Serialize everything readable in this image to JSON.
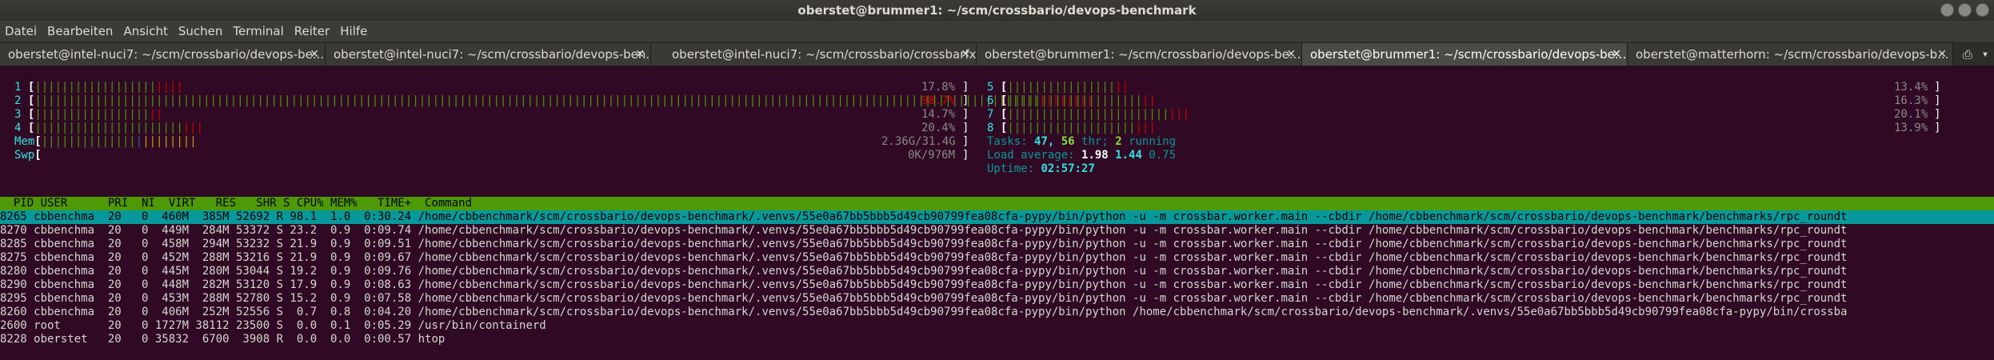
{
  "window": {
    "title": "oberstet@brummer1: ~/scm/crossbario/devops-benchmark"
  },
  "menu": [
    "Datei",
    "Bearbeiten",
    "Ansicht",
    "Suchen",
    "Terminal",
    "Reiter",
    "Hilfe"
  ],
  "tabs": [
    {
      "label": "oberstet@intel-nuci7: ~/scm/crossbario/devops-be...",
      "active": false
    },
    {
      "label": "oberstet@intel-nuci7: ~/scm/crossbario/devops-ben...",
      "active": false
    },
    {
      "label": "oberstet@intel-nuci7: ~/scm/crossbario/crossbarfx",
      "active": false
    },
    {
      "label": "oberstet@brummer1: ~/scm/crossbario/devops-be...",
      "active": false
    },
    {
      "label": "oberstet@brummer1: ~/scm/crossbario/devops-be...",
      "active": true
    },
    {
      "label": "oberstet@matterhorn: ~/scm/crossbario/devops-b...",
      "active": false
    }
  ],
  "meters": {
    "cpu_left": [
      {
        "n": "1",
        "pct": "17.8%"
      },
      {
        "n": "2",
        "pct": "98.7%"
      },
      {
        "n": "3",
        "pct": "14.7%"
      },
      {
        "n": "4",
        "pct": "20.4%"
      }
    ],
    "cpu_right": [
      {
        "n": "5",
        "pct": "13.4%"
      },
      {
        "n": "6",
        "pct": "16.3%"
      },
      {
        "n": "7",
        "pct": "20.1%"
      },
      {
        "n": "8",
        "pct": "13.9%"
      }
    ],
    "mem": {
      "label": "Mem",
      "value": "2.36G/31.4G"
    },
    "swp": {
      "label": "Swp",
      "value": "0K/976M"
    }
  },
  "summary": {
    "tasks_label": "Tasks:",
    "tasks": "47,",
    "thr": "56",
    "thr_label": "thr;",
    "running": "2",
    "running_label": "running",
    "load_label": "Load average:",
    "load1": "1.98",
    "load5": "1.44",
    "load15": "0.75",
    "uptime_label": "Uptime:",
    "uptime": "02:57:27"
  },
  "proc_header": "  PID USER      PRI  NI  VIRT   RES   SHR S CPU% MEM%   TIME+  Command",
  "processes": [
    "8265 cbbenchma  20   0  460M  385M 52692 R 98.1  1.0  0:30.24 /home/cbbenchmark/scm/crossbario/devops-benchmark/.venvs/55e0a67bb5bbb5d49cb90799fea08cfa-pypy/bin/python -u -m crossbar.worker.main --cbdir /home/cbbenchmark/scm/crossbario/devops-benchmark/benchmarks/rpc_roundt",
    "8270 cbbenchma  20   0  449M  284M 53372 S 23.2  0.9  0:09.74 /home/cbbenchmark/scm/crossbario/devops-benchmark/.venvs/55e0a67bb5bbb5d49cb90799fea08cfa-pypy/bin/python -u -m crossbar.worker.main --cbdir /home/cbbenchmark/scm/crossbario/devops-benchmark/benchmarks/rpc_roundt",
    "8285 cbbenchma  20   0  458M  294M 53232 S 21.9  0.9  0:09.51 /home/cbbenchmark/scm/crossbario/devops-benchmark/.venvs/55e0a67bb5bbb5d49cb90799fea08cfa-pypy/bin/python -u -m crossbar.worker.main --cbdir /home/cbbenchmark/scm/crossbario/devops-benchmark/benchmarks/rpc_roundt",
    "8275 cbbenchma  20   0  452M  288M 53216 S 21.9  0.9  0:09.67 /home/cbbenchmark/scm/crossbario/devops-benchmark/.venvs/55e0a67bb5bbb5d49cb90799fea08cfa-pypy/bin/python -u -m crossbar.worker.main --cbdir /home/cbbenchmark/scm/crossbario/devops-benchmark/benchmarks/rpc_roundt",
    "8280 cbbenchma  20   0  445M  280M 53044 S 19.2  0.9  0:09.76 /home/cbbenchmark/scm/crossbario/devops-benchmark/.venvs/55e0a67bb5bbb5d49cb90799fea08cfa-pypy/bin/python -u -m crossbar.worker.main --cbdir /home/cbbenchmark/scm/crossbario/devops-benchmark/benchmarks/rpc_roundt",
    "8290 cbbenchma  20   0  448M  282M 53120 S 17.9  0.9  0:08.63 /home/cbbenchmark/scm/crossbario/devops-benchmark/.venvs/55e0a67bb5bbb5d49cb90799fea08cfa-pypy/bin/python -u -m crossbar.worker.main --cbdir /home/cbbenchmark/scm/crossbario/devops-benchmark/benchmarks/rpc_roundt",
    "8295 cbbenchma  20   0  453M  288M 52780 S 15.2  0.9  0:07.58 /home/cbbenchmark/scm/crossbario/devops-benchmark/.venvs/55e0a67bb5bbb5d49cb90799fea08cfa-pypy/bin/python -u -m crossbar.worker.main --cbdir /home/cbbenchmark/scm/crossbario/devops-benchmark/benchmarks/rpc_roundt",
    "8260 cbbenchma  20   0  406M  252M 52556 S  0.7  0.8  0:04.20 /home/cbbenchmark/scm/crossbario/devops-benchmark/.venvs/55e0a67bb5bbb5d49cb90799fea08cfa-pypy/bin/python /home/cbbenchmark/scm/crossbario/devops-benchmark/.venvs/55e0a67bb5bbb5d49cb90799fea08cfa-pypy/bin/crossba",
    "2600 root       20   0 1727M 38112 23500 S  0.0  0.1  0:05.29 /usr/bin/containerd",
    "8228 oberstet   20   0 35832  6700  3908 R  0.0  0.0  0:00.57 htop"
  ]
}
